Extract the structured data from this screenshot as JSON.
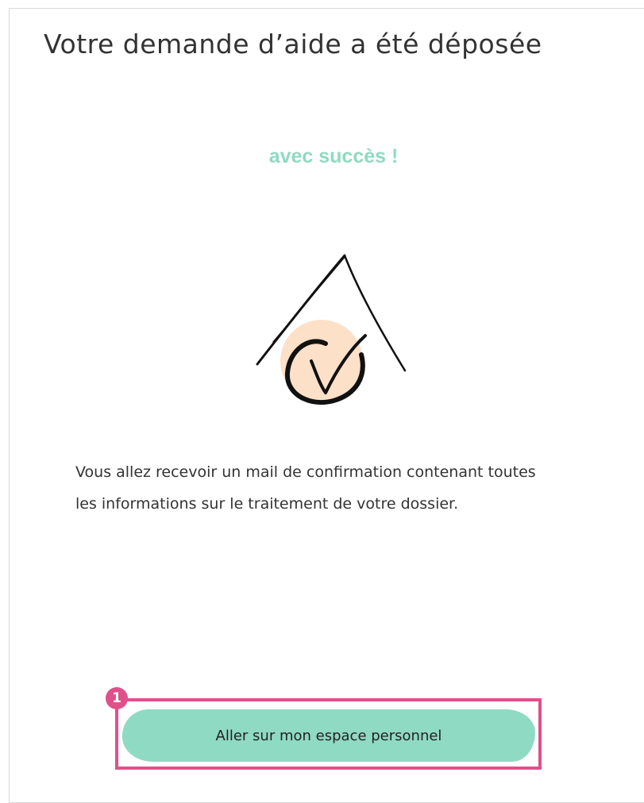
{
  "header": {
    "title": "Votre demande d’aide a été déposée",
    "subtitle": "avec succès !"
  },
  "illustration": {
    "icon": "house-checkmark-icon",
    "circle_color": "#fde0c8",
    "stroke_color": "#111111"
  },
  "message": {
    "text": "Vous allez recevoir un mail de confirmation contenant toutes les informations sur le traitement de votre dossier."
  },
  "cta": {
    "label": "Aller sur mon espace personnel",
    "color": "#8fdac2"
  },
  "annotation": {
    "step_number": "1",
    "color": "#e0508a"
  },
  "colors": {
    "accent": "#8fdac2",
    "highlight": "#e0508a",
    "text": "#333333"
  }
}
